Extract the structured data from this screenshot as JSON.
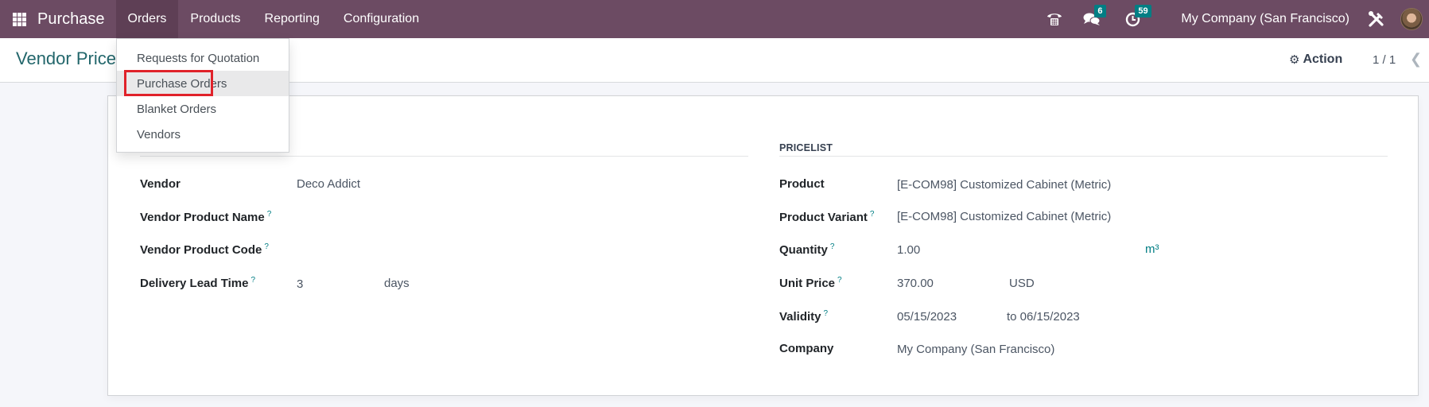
{
  "navbar": {
    "app_name": "Purchase",
    "menu": [
      {
        "label": "Orders",
        "active": true
      },
      {
        "label": "Products",
        "active": false
      },
      {
        "label": "Reporting",
        "active": false
      },
      {
        "label": "Configuration",
        "active": false
      }
    ],
    "icons": {
      "apps": "apps-grid-icon",
      "phone": "phone-icon",
      "messages": "chat-icon",
      "activities": "clock-icon",
      "settings": "tools-icon"
    },
    "messages_count": "6",
    "activities_count": "59",
    "company": "My Company (San Francisco)",
    "colors": {
      "navbar": "#6c4b63",
      "badge": "#017e84"
    }
  },
  "control_panel": {
    "title": "Vendor Price",
    "action_label": "Action",
    "pager": "1 / 1"
  },
  "orders_dropdown": {
    "items": [
      {
        "label": "Requests for Quotation"
      },
      {
        "label": "Purchase Orders",
        "highlighted": true
      },
      {
        "label": "Blanket Orders"
      },
      {
        "label": "Vendors"
      }
    ],
    "highlight_color": "#e0222a"
  },
  "form": {
    "left": {
      "fields": [
        {
          "label": "Vendor",
          "help": false,
          "value": "Deco Addict"
        },
        {
          "label": "Vendor Product Name",
          "help": true,
          "value": ""
        },
        {
          "label": "Vendor Product Code",
          "help": true,
          "value": ""
        },
        {
          "label": "Delivery Lead Time",
          "help": true,
          "value": "3",
          "unit": "days"
        }
      ]
    },
    "right": {
      "heading": "PRICELIST",
      "fields": [
        {
          "label": "Product",
          "help": false,
          "value": "[E-COM98] Customized Cabinet (Metric)"
        },
        {
          "label": "Product Variant",
          "help": true,
          "value": "[E-COM98] Customized Cabinet (Metric)"
        },
        {
          "label": "Quantity",
          "help": true,
          "value": "1.00",
          "unit": "m³"
        },
        {
          "label": "Unit Price",
          "help": true,
          "value": "370.00",
          "unit": "USD"
        },
        {
          "label": "Validity",
          "help": true,
          "value": "05/15/2023",
          "end": "to 06/15/2023"
        },
        {
          "label": "Company",
          "help": false,
          "value": "My Company (San Francisco)"
        }
      ]
    },
    "help_mark": "?"
  }
}
